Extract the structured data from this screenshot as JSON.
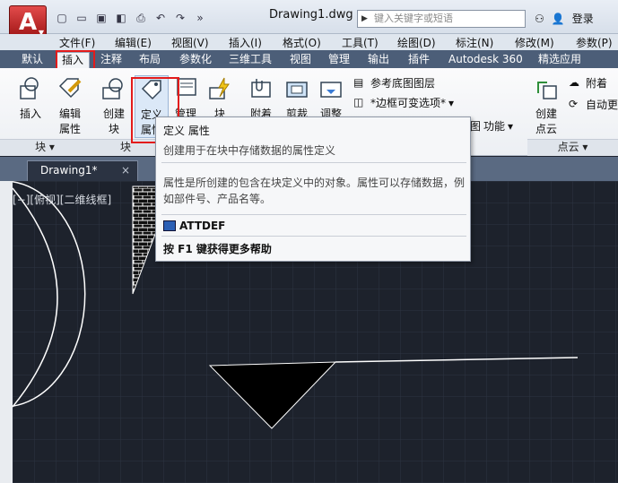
{
  "app": {
    "document_title": "Drawing1.dwg",
    "search_placeholder": "键入关键字或短语",
    "login_label": "登录"
  },
  "menu": [
    "文件(F)",
    "编辑(E)",
    "视图(V)",
    "插入(I)",
    "格式(O)",
    "工具(T)",
    "绘图(D)",
    "标注(N)",
    "修改(M)",
    "参数(P)"
  ],
  "tabs": [
    "默认",
    "插入",
    "注释",
    "布局",
    "参数化",
    "三维工具",
    "视图",
    "管理",
    "输出",
    "插件",
    "Autodesk 360",
    "精选应用"
  ],
  "ribbon": {
    "insert_label": "插入",
    "edit_attr_label1": "编辑",
    "edit_attr_label2": "属性",
    "create_block_label1": "创建",
    "create_block_label2": "块",
    "define_attr_label1": "定义",
    "define_attr_label2": "属性",
    "manage_label": "管理",
    "block_label": "块",
    "attach_label": "附着",
    "clip_label": "剪裁",
    "adjust_label": "调整",
    "ref_underlay_label": "参考底图图层",
    "frame_label": "*边框可变选项*",
    "function_label": "功能",
    "create_cloud_label1": "创建",
    "create_cloud_label2": "点云",
    "attach2_label": "附着",
    "auto_label": "自动更",
    "panel_block": "块",
    "panel_block_def": "块",
    "panel_cloud": "点云",
    "map_label": "图"
  },
  "doc_tab": {
    "label": "Drawing1*"
  },
  "viewport": {
    "label": "[−][俯视][二维线框]"
  },
  "tooltip": {
    "title": "定义 属性",
    "short": "创建用于在块中存储数据的属性定义",
    "long": "属性是所创建的包含在块定义中的对象。属性可以存储数据，例如部件号、产品名等。",
    "command": "ATTDEF",
    "help": "按 F1 键获得更多帮助"
  },
  "colors": {
    "highlight": "#e31b1b",
    "tab_bar": "#4c5e78",
    "canvas": "#1d222c"
  }
}
